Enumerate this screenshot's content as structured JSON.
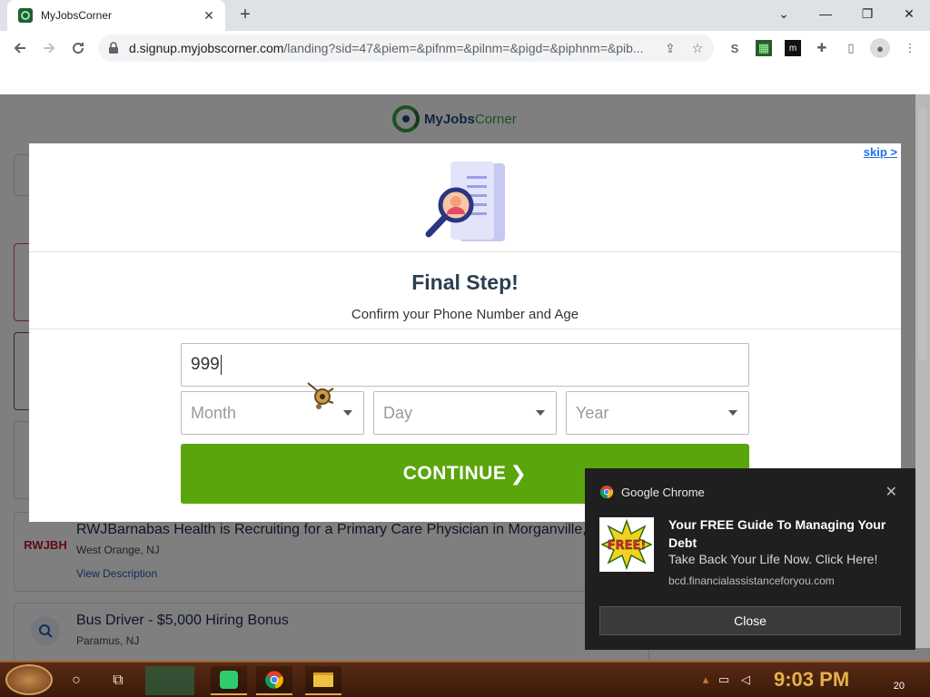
{
  "browser": {
    "tab_title": "MyJobsCorner",
    "tab_close": "✕",
    "new_tab": "+",
    "url_domain": "d.signup.myjobscorner.com",
    "url_path": "/landing?sid=47&piem=&pifnm=&pilnm=&pigd=&piphnm=&pib...",
    "window_controls": [
      "⌄",
      "—",
      "❐",
      "✕"
    ]
  },
  "site": {
    "logo_word1": "MyJobs",
    "logo_word2": "Corner",
    "jobs": [
      {
        "logo_text": "RWJBH",
        "title": "RWJBarnabas Health is Recruiting for a Primary Care Physician in Morganville,",
        "location": "West Orange, NJ",
        "link": "View Description"
      },
      {
        "logo_text": "",
        "title": "Bus Driver - $5,000 Hiring Bonus",
        "location": "Paramus, NJ",
        "link": ""
      }
    ]
  },
  "modal": {
    "skip": "skip >",
    "title": "Final Step!",
    "subtitle": "Confirm your Phone Number and Age",
    "phone_value": "999",
    "month_placeholder": "Month",
    "day_placeholder": "Day",
    "year_placeholder": "Year",
    "continue_label": "CONTINUE",
    "continue_chevron": "❯",
    "accent_color": "#5aa50c"
  },
  "notification": {
    "app_name": "Google Chrome",
    "close": "✕",
    "image_text": "FREE!",
    "title": "Your FREE Guide To Managing Your Debt",
    "body": "Take Back Your Life Now. Click Here!",
    "site": "bcd.financialassistanceforyou.com",
    "button": "Close"
  },
  "taskbar": {
    "time": "9:03 PM",
    "notification_count": "20"
  }
}
